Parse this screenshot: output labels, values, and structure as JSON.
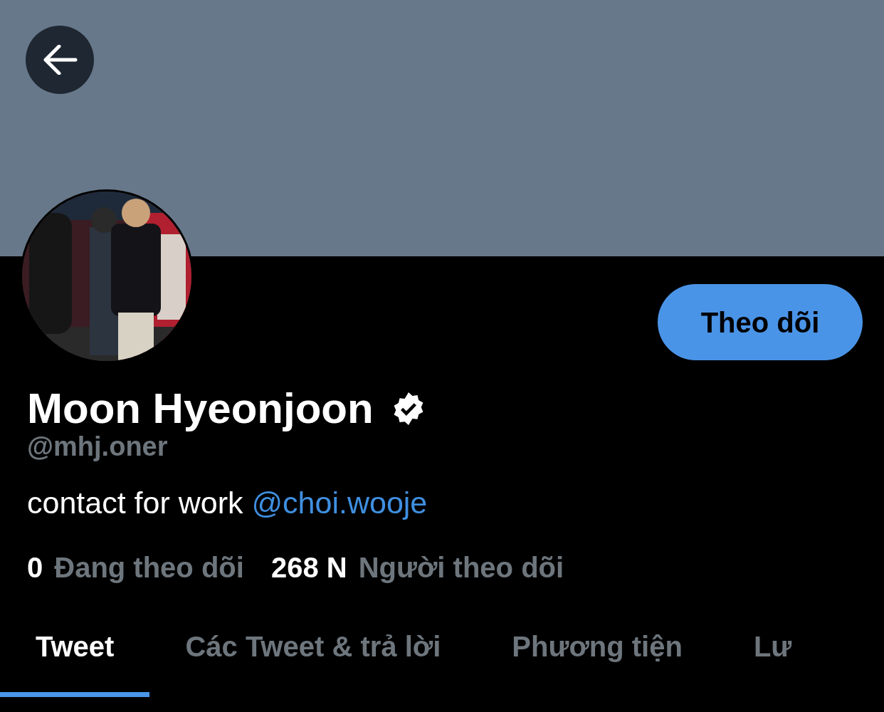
{
  "profile": {
    "name": "Moon Hyeonjoon",
    "verified": true,
    "handle": "@mhj.oner",
    "bio": "contact for work ",
    "bio_link": "@choi.wooje",
    "follow_button": "Theo dõi"
  },
  "stats": [
    {
      "count": "0",
      "label": "Đang theo dõi"
    },
    {
      "count": "268 N",
      "label": "Người theo dõi"
    }
  ],
  "tabs": [
    {
      "label": "Tweet",
      "selected": true
    },
    {
      "label": "Các Tweet & trả lời",
      "selected": false
    },
    {
      "label": "Phương tiện",
      "selected": false
    },
    {
      "label": "Lư",
      "selected": false
    }
  ]
}
